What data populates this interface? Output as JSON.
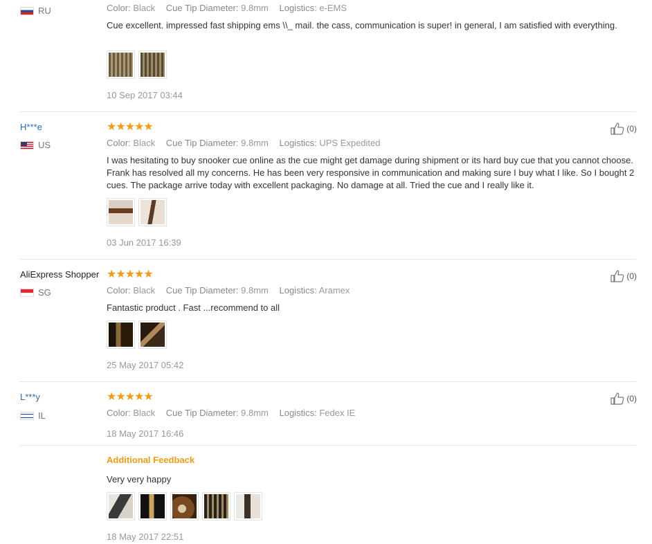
{
  "labels": {
    "color": "Color:",
    "tip": "Cue Tip Diameter:",
    "logistics": "Logistics:"
  },
  "reviews": [
    {
      "user": "",
      "country": "RU",
      "color": "Black",
      "tip": "9.8mm",
      "logistics": "e-EMS",
      "text": "Cue excellent. impressed fast shipping ems \\\\_ mail. the cass, communication is super! in general, I am satisfied with everything.",
      "date": "10 Sep 2017 03:44"
    },
    {
      "user": "H***e",
      "country": "US",
      "stars": "★★★★★",
      "helpful": "(0)",
      "color": "Black",
      "tip": "9.8mm",
      "logistics": "UPS Expedited",
      "text": "I was hesitating to buy snooker cue online as the cue might get damage during shipment or its hard buy cue that you cannot choose. Frank has resolved all my concerns. He has been very responsive in communication and making sure I buy what I like. So I bought 2 cues. The package arrive today with excellent packaging. No damage at all. Tried the cue and I really like it.",
      "date": "03 Jun 2017 16:39"
    },
    {
      "user": "AliExpress Shopper",
      "country": "SG",
      "stars": "★★★★★",
      "helpful": "(0)",
      "color": "Black",
      "tip": "9.8mm",
      "logistics": "Aramex",
      "text": "Fantastic product . Fast ...recommend to all",
      "date": "25 May 2017 05:42"
    },
    {
      "user": "L***y",
      "country": "IL",
      "stars": "★★★★★",
      "helpful": "(0)",
      "color": "Black",
      "tip": "9.8mm",
      "logistics": "Fedex IE",
      "date": "18 May 2017 16:46",
      "additional_title": "Additional Feedback",
      "additional_text": "Very very happy",
      "additional_date": "18 May 2017 22:51"
    }
  ]
}
